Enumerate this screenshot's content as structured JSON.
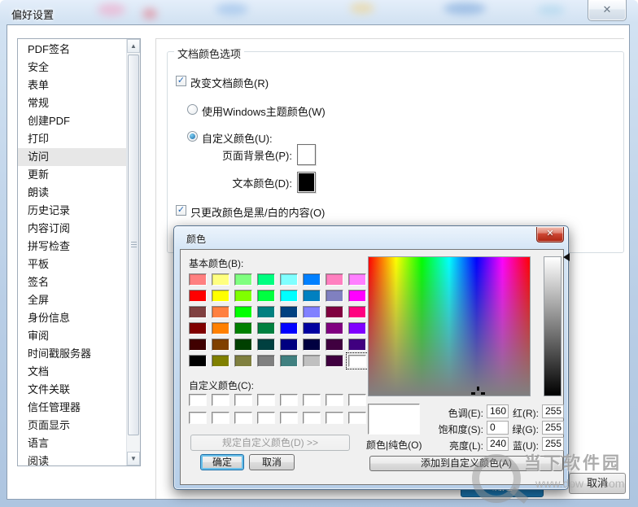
{
  "window": {
    "title": "偏好设置",
    "close_glyph": "✕",
    "ok_label": "确定",
    "cancel_label": "取消"
  },
  "sidebar": {
    "items": [
      {
        "label": "PDF签名",
        "selected": false
      },
      {
        "label": "安全",
        "selected": false
      },
      {
        "label": "表单",
        "selected": false
      },
      {
        "label": "常规",
        "selected": false
      },
      {
        "label": "创建PDF",
        "selected": false
      },
      {
        "label": "打印",
        "selected": false
      },
      {
        "label": "访问",
        "selected": true
      },
      {
        "label": "更新",
        "selected": false
      },
      {
        "label": "朗读",
        "selected": false
      },
      {
        "label": "历史记录",
        "selected": false
      },
      {
        "label": "内容订阅",
        "selected": false
      },
      {
        "label": "拼写检查",
        "selected": false
      },
      {
        "label": "平板",
        "selected": false
      },
      {
        "label": "签名",
        "selected": false
      },
      {
        "label": "全屏",
        "selected": false
      },
      {
        "label": "身份信息",
        "selected": false
      },
      {
        "label": "审阅",
        "selected": false
      },
      {
        "label": "时间戳服务器",
        "selected": false
      },
      {
        "label": "文档",
        "selected": false
      },
      {
        "label": "文件关联",
        "selected": false
      },
      {
        "label": "信任管理器",
        "selected": false
      },
      {
        "label": "页面显示",
        "selected": false
      },
      {
        "label": "语言",
        "selected": false
      },
      {
        "label": "阅读",
        "selected": false
      }
    ],
    "scroll_up_glyph": "▲",
    "scroll_down_glyph": "▼"
  },
  "content": {
    "group_title": "文档颜色选项",
    "change_doc_colors_label": "改变文档颜色(R)",
    "change_doc_colors_checked": true,
    "use_windows_theme_label": "使用Windows主题颜色(W)",
    "use_windows_theme_selected": false,
    "custom_color_label": "自定义颜色(U):",
    "custom_color_selected": true,
    "page_bg_label": "页面背景色(P):",
    "page_bg_color": "#FFFFFF",
    "text_color_label": "文本颜色(D):",
    "text_color_value": "#000000",
    "only_bw_label": "只更改颜色是黑/白的内容(O)",
    "only_bw_checked": true,
    "check_glyph": "✓"
  },
  "color_dialog": {
    "title": "颜色",
    "close_glyph": "✕",
    "basic_label": "基本颜色(B):",
    "basic_colors": [
      "#FF8080",
      "#FFFF80",
      "#80FF80",
      "#00FF80",
      "#80FFFF",
      "#0080FF",
      "#FF80C0",
      "#FF80FF",
      "#FF0000",
      "#FFFF00",
      "#80FF00",
      "#00FF40",
      "#00FFFF",
      "#0080C0",
      "#8080C0",
      "#FF00FF",
      "#804040",
      "#FF8040",
      "#00FF00",
      "#008080",
      "#004080",
      "#8080FF",
      "#800040",
      "#FF0080",
      "#800000",
      "#FF8000",
      "#008000",
      "#008040",
      "#0000FF",
      "#0000A0",
      "#800080",
      "#8000FF",
      "#400000",
      "#804000",
      "#004000",
      "#004040",
      "#000080",
      "#000040",
      "#400040",
      "#400080",
      "#000000",
      "#808000",
      "#808040",
      "#808080",
      "#408080",
      "#C0C0C0",
      "#400040",
      "#FFFFFF"
    ],
    "selected_basic_index": 47,
    "custom_label": "自定义颜色(C):",
    "custom_colors": [
      "#FFFFFF",
      "#FFFFFF",
      "#FFFFFF",
      "#FFFFFF",
      "#FFFFFF",
      "#FFFFFF",
      "#FFFFFF",
      "#FFFFFF",
      "#FFFFFF",
      "#FFFFFF",
      "#FFFFFF",
      "#FFFFFF",
      "#FFFFFF",
      "#FFFFFF",
      "#FFFFFF",
      "#FFFFFF"
    ],
    "define_custom_label": "规定自定义颜色(D) >>",
    "ok_label": "确定",
    "cancel_label": "取消",
    "preview_label": "颜色|纯色(O)",
    "preview_color": "#FFFFFF",
    "fields": [
      {
        "label": "色调(E):",
        "value": "160"
      },
      {
        "label": "饱和度(S):",
        "value": "0"
      },
      {
        "label": "亮度(L):",
        "value": "240"
      },
      {
        "label": "红(R):",
        "value": "255"
      },
      {
        "label": "绿(G):",
        "value": "255"
      },
      {
        "label": "蓝(U):",
        "value": "255"
      }
    ],
    "add_custom_label": "添加到自定义颜色(A)"
  },
  "watermark": {
    "site_name": "当下软件园",
    "url_left": "www.dow",
    "url_right": "com"
  }
}
